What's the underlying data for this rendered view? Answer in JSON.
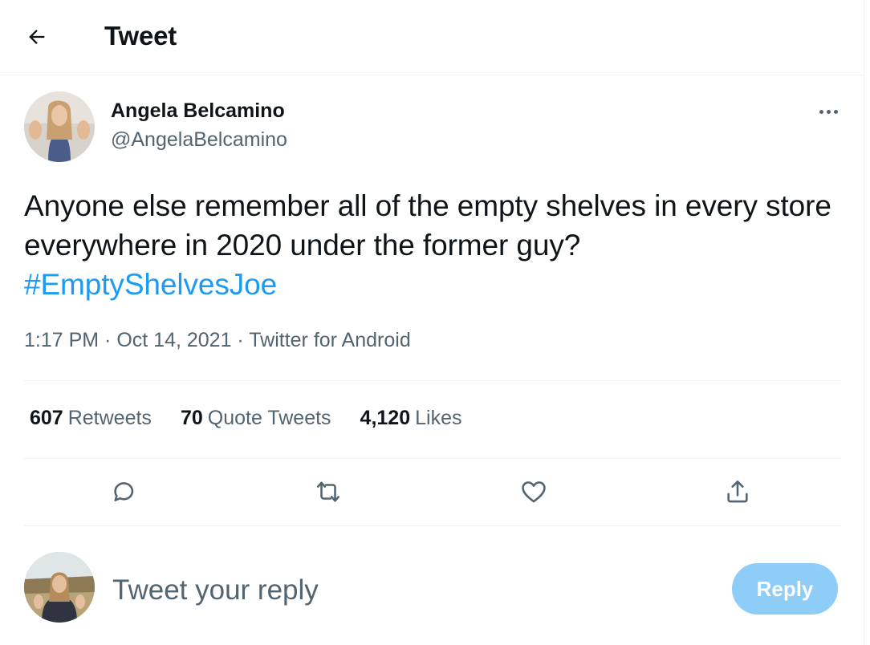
{
  "header": {
    "title": "Tweet",
    "back_icon": "arrow-left-icon"
  },
  "tweet": {
    "author": {
      "name": "Angela Belcamino",
      "handle": "@AngelaBelcamino"
    },
    "text": "Anyone else remember all of the empty shelves in every store everywhere in 2020 under the former guy?",
    "hashtag": "#EmptyShelvesJoe",
    "time": "1:17 PM",
    "separator": " · ",
    "date": "Oct 14, 2021",
    "source": "Twitter for Android",
    "stats": {
      "retweets_count": "607",
      "retweets_label": "Retweets",
      "quotes_count": "70",
      "quotes_label": "Quote Tweets",
      "likes_count": "4,120",
      "likes_label": "Likes"
    },
    "actions": [
      "reply-icon",
      "retweet-icon",
      "like-icon",
      "share-icon"
    ]
  },
  "reply": {
    "placeholder": "Tweet your reply",
    "button_label": "Reply"
  },
  "colors": {
    "link": "#1d9bf0",
    "secondary_text": "#536471",
    "reply_button_disabled": "#8ecdf8",
    "divider": "#eff3f4"
  }
}
